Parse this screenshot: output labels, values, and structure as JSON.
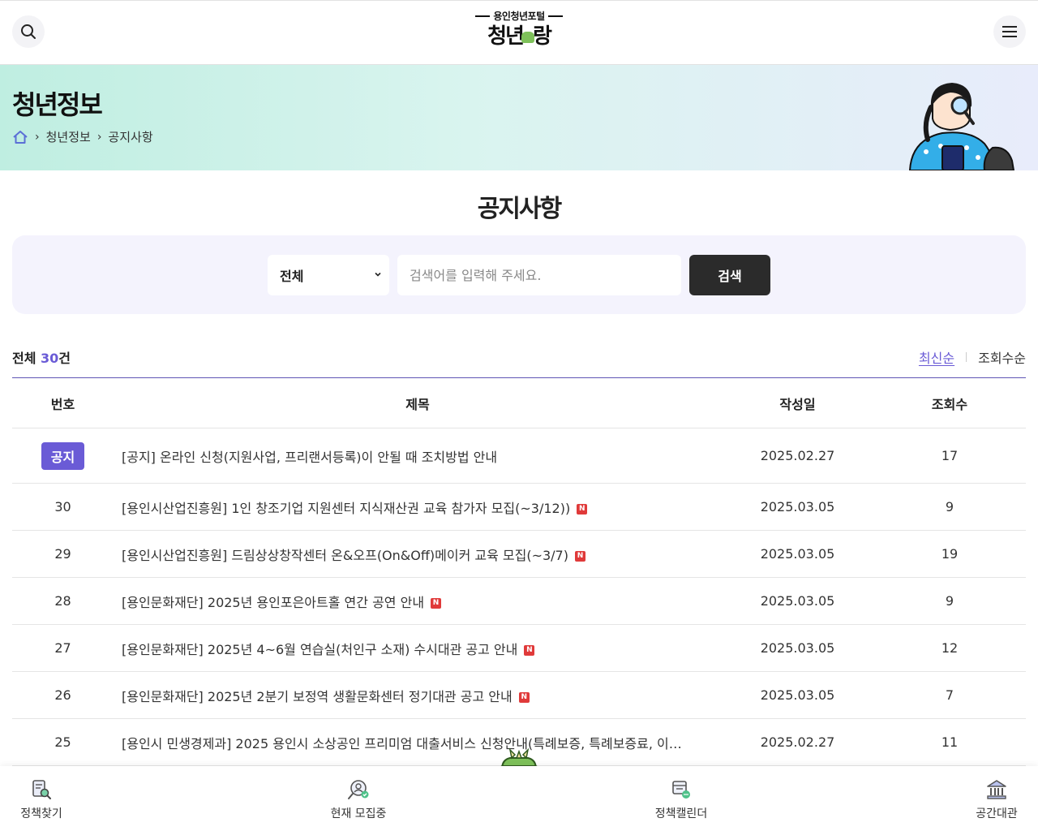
{
  "header": {
    "logo_sub": "용인청년포털",
    "logo_main_left": "청년",
    "logo_main_right": "랑",
    "search_icon": "search-icon",
    "menu_icon": "hamburger-menu-icon"
  },
  "hero": {
    "title": "청년정보",
    "breadcrumb": [
      "청년정보",
      "공지사항"
    ],
    "home_icon": "home-icon"
  },
  "page": {
    "title": "공지사항"
  },
  "search": {
    "select_value": "전체",
    "placeholder": "검색어를 입력해 주세요.",
    "button_label": "검색"
  },
  "listing": {
    "count_prefix": "전체 ",
    "count": "30",
    "count_suffix": "건",
    "sort_active": "최신순",
    "sort_other": "조회수순"
  },
  "table": {
    "headers": {
      "no": "번호",
      "title": "제목",
      "date": "작성일",
      "views": "조회수"
    },
    "rows": [
      {
        "no": "공지",
        "title": "[공지] 온라인 신청(지원사업, 프리랜서등록)이 안될 때 조치방법 안내",
        "date": "2025.02.27",
        "views": "17"
      },
      {
        "no": "30",
        "title": "[용인시산업진흥원] 1인 창조기업 지원센터 지식재산권 교육 참가자 모집(~3/12))",
        "date": "2025.03.05",
        "views": "9"
      },
      {
        "no": "29",
        "title": "[용인시산업진흥원] 드림상상창작센터 온&오프(On&Off)메이커 교육 모집(~3/7)",
        "date": "2025.03.05",
        "views": "19"
      },
      {
        "no": "28",
        "title": "[용인문화재단] 2025년 용인포은아트홀 연간 공연 안내",
        "date": "2025.03.05",
        "views": "9"
      },
      {
        "no": "27",
        "title": "[용인문화재단] 2025년 4~6월 연습실(처인구 소재) 수시대관 공고 안내",
        "date": "2025.03.05",
        "views": "12"
      },
      {
        "no": "26",
        "title": "[용인문화재단] 2025년 2분기 보정역 생활문화센터 정기대관 공고 안내",
        "date": "2025.03.05",
        "views": "7"
      },
      {
        "no": "25",
        "title": "[용인시 민생경제과] 2025 용인시 소상공인 프리미엄 대출서비스 신청안내(특례보증, 특례보증료, 이…",
        "date": "2025.02.27",
        "views": "11"
      }
    ],
    "new_label": "N"
  },
  "bottom_nav": {
    "items": [
      "정책찾기",
      "현재 모집중",
      "정책캘린더",
      "공간대관"
    ]
  },
  "colors": {
    "accent": "#6a5bd6",
    "dark_button": "#2b2b2b",
    "new_badge": "#e03a3a",
    "search_panel": "#f4f3fd"
  }
}
